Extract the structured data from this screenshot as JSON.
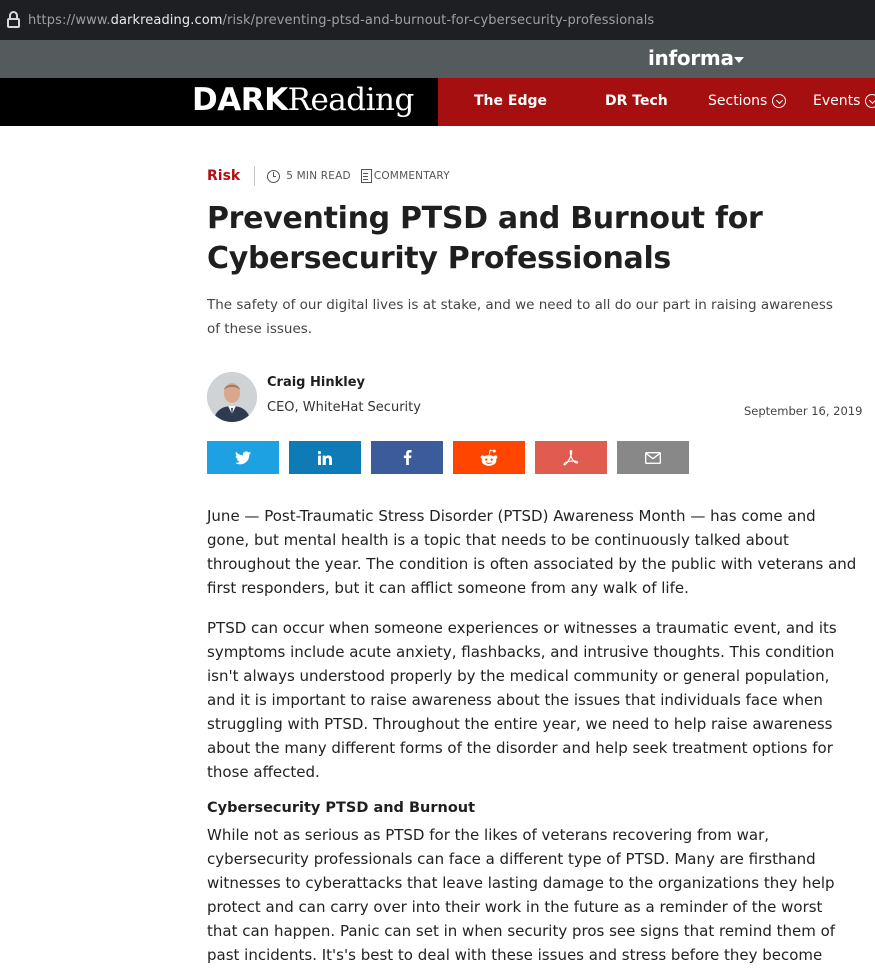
{
  "browser": {
    "url_prefix": "https://www.",
    "url_domain": "darkreading.com",
    "url_path": "/risk/preventing-ptsd-and-burnout-for-cybersecurity-professionals"
  },
  "topbar": {
    "brand": "informa"
  },
  "nav": {
    "logo_dark": "DARK",
    "logo_reading": "Reading",
    "items": [
      {
        "label": "The Edge"
      },
      {
        "label": "DR Tech"
      },
      {
        "label": "Sections"
      },
      {
        "label": "Events"
      }
    ]
  },
  "article": {
    "category": "Risk",
    "read_time": "5 MIN READ",
    "type": "COMMENTARY",
    "title": "Preventing PTSD and Burnout for Cybersecurity Professionals",
    "subtitle": "The safety of our digital lives is at stake, and we need to all do our part in raising awareness of these issues.",
    "author_name": "Craig Hinkley",
    "author_role": "CEO, WhiteHat Security",
    "date": "September 16, 2019",
    "paragraphs": [
      "June — Post-Traumatic Stress Disorder (PTSD) Awareness Month — has come and gone, but mental health is a topic that needs to be continuously talked about throughout the year. The condition is often associated by the public with veterans and first responders, but it can afflict someone from any walk of life.",
      "PTSD can occur when someone experiences or witnesses a traumatic event, and its symptoms include acute anxiety, flashbacks, and intrusive thoughts. This condition isn't always understood properly by the medical community or general population, and it is important to raise awareness about the issues that individuals face when struggling with PTSD. Throughout the entire year, we need to help raise awareness about the many different forms of the disorder and help seek treatment options for those affected.",
      "While not as serious as PTSD for the likes of veterans recovering from war, cybersecurity professionals can face a different type of PTSD. Many are firsthand witnesses to cyberattacks that leave lasting damage to the organizations they help protect and can carry over into their work in the future as a reminder of the worst that can happen. Panic can set in when security pros see signs that remind them of past incidents. It's's best to deal with these issues and stress before they become lasting"
    ],
    "section_heading": "Cybersecurity PTSD and Burnout"
  },
  "share_buttons": [
    {
      "icon": "twitter-icon",
      "color": "#1da1e2"
    },
    {
      "icon": "linkedin-icon",
      "color": "#0e7ab6"
    },
    {
      "icon": "facebook-icon",
      "color": "#3b5b9b"
    },
    {
      "icon": "reddit-icon",
      "color": "#ff4500"
    },
    {
      "icon": "pdf-icon",
      "color": "#e05b50"
    },
    {
      "icon": "email-icon",
      "color": "#888888"
    }
  ]
}
